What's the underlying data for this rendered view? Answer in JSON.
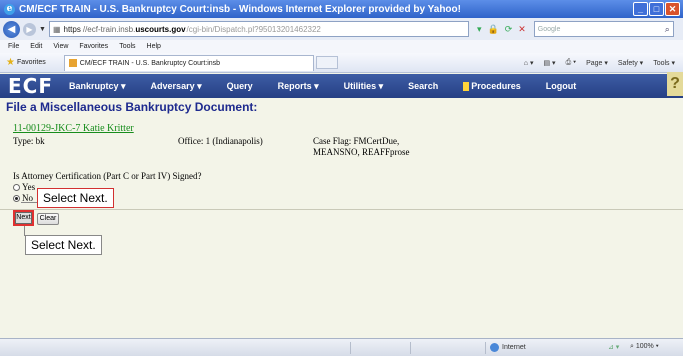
{
  "window": {
    "title": "CM/ECF TRAIN - U.S. Bankruptcy Court:insb - Windows Internet Explorer provided by Yahoo!",
    "controls": [
      "_",
      "□",
      "✕"
    ]
  },
  "address_bar": {
    "protocol": "https",
    "pre": "//ecf-train.insb.",
    "domain": "uscourts.gov",
    "path": "/cgi-bin/Dispatch.pl?95013201462322",
    "search_placeholder": "Google"
  },
  "menu": [
    "File",
    "Edit",
    "View",
    "Favorites",
    "Tools",
    "Help"
  ],
  "favorites": {
    "label": "Favorites",
    "tab_title": "CM/ECF TRAIN - U.S. Bankruptcy Court:insb",
    "commands": [
      "Page ▾",
      "Safety ▾",
      "Tools ▾"
    ]
  },
  "ecf_nav": {
    "logo": "ECF",
    "items": [
      "Bankruptcy ▾",
      "Adversary ▾",
      "Query",
      "Reports ▾",
      "Utilities ▾",
      "Search"
    ],
    "procedures": "Procedures",
    "logout": "Logout",
    "help": "?"
  },
  "page": {
    "title": "File a Miscellaneous Bankruptcy Document:",
    "case_link": "11-00129-JKC-7 Katie Kritter",
    "type": "Type: bk",
    "office": "Office: 1 (Indianapolis)",
    "case_flag_line1": "Case Flag: FMCertDue,",
    "case_flag_line2": "MEANSNO, REAFFprose",
    "question": "Is Attorney Certification (Part C or Part IV) Signed?",
    "options": [
      {
        "label": "Yes",
        "selected": false
      },
      {
        "label": "No",
        "selected": true
      }
    ],
    "next_button": "Next",
    "clear_button": "Clear"
  },
  "callouts": {
    "top": "Select Next.",
    "bottom": "Select Next."
  },
  "status_bar": {
    "zone": "Internet",
    "zoom": "100%"
  }
}
